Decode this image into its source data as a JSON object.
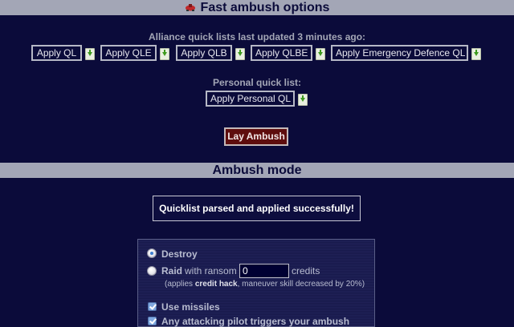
{
  "header": {
    "title": "Fast ambush options",
    "icon": "ship-icon"
  },
  "alliance": {
    "caption": "Alliance quick lists last updated 3 minutes ago:",
    "buttons": [
      {
        "label": "Apply QL"
      },
      {
        "label": "Apply QLE"
      },
      {
        "label": "Apply QLB"
      },
      {
        "label": "Apply QLBE"
      },
      {
        "label": "Apply Emergency Defence QL"
      }
    ]
  },
  "personal": {
    "caption": "Personal quick list:",
    "button_label": "Apply Personal QL"
  },
  "lay_ambush_label": "Lay Ambush",
  "mode_section": {
    "title": "Ambush mode",
    "message": "Quicklist parsed and applied successfully!"
  },
  "options": {
    "destroy_label": "Destroy",
    "raid_label": "Raid",
    "raid_with_ransom": "with ransom",
    "ransom_value": "0",
    "credits_label": "credits",
    "note_prefix": "(applies",
    "note_bold": "credit hack",
    "note_suffix": ", maneuver skill decreased by 20%)",
    "use_missiles_label": "Use missiles",
    "trigger_label": "Any attacking pilot triggers your ambush"
  },
  "colors": {
    "background": "#0b0b3a",
    "bar": "#a3a6b6",
    "lay_button": "#5e0d0d",
    "download_arrow": "#3d9a1e"
  }
}
